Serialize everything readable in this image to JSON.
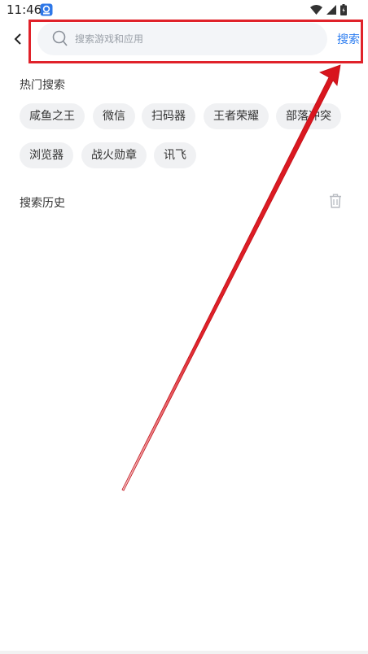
{
  "status_bar": {
    "time": "11:46"
  },
  "header": {
    "search_placeholder": "搜索游戏和应用",
    "search_button_label": "搜索"
  },
  "hot_search": {
    "title": "热门搜索",
    "chips": [
      "咸鱼之王",
      "微信",
      "扫码器",
      "王者荣耀",
      "部落冲突",
      "浏览器",
      "战火勋章",
      "讯飞"
    ]
  },
  "history": {
    "title": "搜索历史"
  },
  "colors": {
    "accent": "#2b7cf0",
    "highlight": "#e0222a",
    "chip_bg": "#f0f1f3"
  }
}
